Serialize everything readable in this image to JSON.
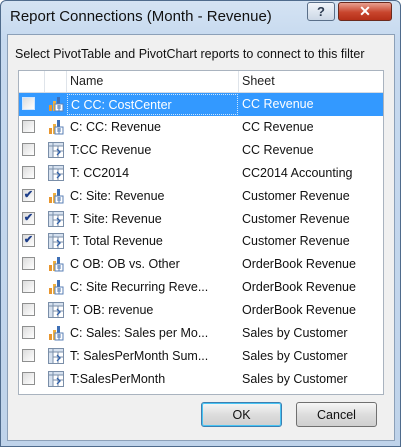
{
  "window": {
    "title": "Report Connections (Month - Revenue)",
    "help_label": "?",
    "close_label": "✕"
  },
  "dialog": {
    "instruction": "Select PivotTable and PivotChart reports to connect to this filter",
    "columns": {
      "name": "Name",
      "sheet": "Sheet"
    },
    "rows": [
      {
        "name": "C CC: CostCenter",
        "sheet": "CC Revenue",
        "checked": false,
        "icon": "pivotchart-icon",
        "selected": true,
        "check": ""
      },
      {
        "name": "C: CC: Revenue",
        "sheet": "CC Revenue",
        "checked": false,
        "icon": "pivotchart-icon",
        "selected": false,
        "check": ""
      },
      {
        "name": "T:CC Revenue",
        "sheet": "CC Revenue",
        "checked": false,
        "icon": "pivottable-icon",
        "selected": false,
        "check": ""
      },
      {
        "name": "T: CC2014",
        "sheet": "CC2014 Accounting",
        "checked": false,
        "icon": "pivottable-icon",
        "selected": false,
        "check": ""
      },
      {
        "name": "C: Site: Revenue",
        "sheet": "Customer Revenue",
        "checked": true,
        "icon": "pivotchart-icon",
        "selected": false,
        "check": "✔"
      },
      {
        "name": "T: Site: Revenue",
        "sheet": "Customer Revenue",
        "checked": true,
        "icon": "pivottable-icon",
        "selected": false,
        "check": "✔"
      },
      {
        "name": "T: Total Revenue",
        "sheet": "Customer Revenue",
        "checked": true,
        "icon": "pivottable-icon",
        "selected": false,
        "check": "✔"
      },
      {
        "name": "C OB: OB vs. Other",
        "sheet": "OrderBook Revenue",
        "checked": false,
        "icon": "pivotchart-icon",
        "selected": false,
        "check": ""
      },
      {
        "name": "C: Site Recurring Reve...",
        "sheet": "OrderBook Revenue",
        "checked": false,
        "icon": "pivotchart-icon",
        "selected": false,
        "check": ""
      },
      {
        "name": "T: OB: revenue",
        "sheet": "OrderBook Revenue",
        "checked": false,
        "icon": "pivottable-icon",
        "selected": false,
        "check": ""
      },
      {
        "name": "C: Sales: Sales per Mo...",
        "sheet": "Sales by Customer",
        "checked": false,
        "icon": "pivotchart-icon",
        "selected": false,
        "check": ""
      },
      {
        "name": "T: SalesPerMonth Sum...",
        "sheet": "Sales by Customer",
        "checked": false,
        "icon": "pivottable-icon",
        "selected": false,
        "check": ""
      },
      {
        "name": "T:SalesPerMonth",
        "sheet": "Sales by Customer",
        "checked": false,
        "icon": "pivottable-icon",
        "selected": false,
        "check": ""
      }
    ]
  },
  "buttons": {
    "ok": "OK",
    "cancel": "Cancel"
  },
  "colors": {
    "selection": "#3399ff",
    "chart_orange": "#e8962e",
    "chart_blue": "#3e6fb5"
  }
}
